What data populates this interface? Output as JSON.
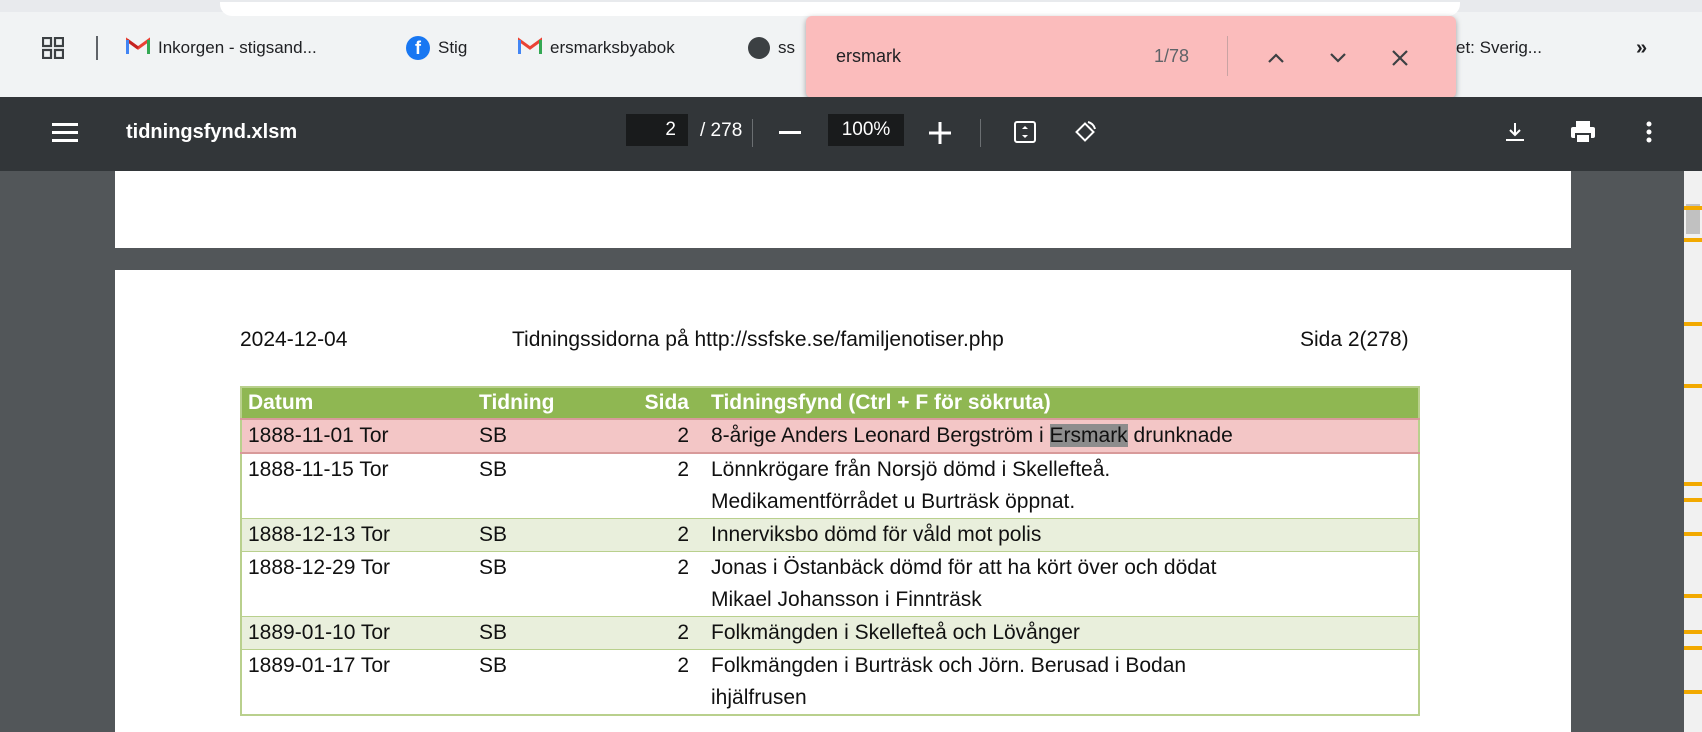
{
  "bookmarks": {
    "items": [
      {
        "label": "Inkorgen - stigsand...",
        "icon": "gmail-icon"
      },
      {
        "label": "Stig",
        "icon": "facebook-icon"
      },
      {
        "label": "ersmarksbyabok",
        "icon": "gmail-icon"
      },
      {
        "label": "ss",
        "icon": "globe-icon"
      },
      {
        "label": "et: Sverig...",
        "icon": ""
      }
    ],
    "overflow": "»"
  },
  "find": {
    "query": "ersmark",
    "count": "1/78"
  },
  "toolbar": {
    "filename": "tidningsfynd.xlsm",
    "page": "2",
    "page_total": "/ 278",
    "zoom": "100%"
  },
  "doc": {
    "date": "2024-12-04",
    "source": "Tidningssidorna på http://ssfske.se/familjenotiser.php",
    "page_label": "Sida  2(278)",
    "columns": [
      "Datum",
      "Tidning",
      "Sida",
      "Tidningsfynd (Ctrl + F för sökruta)"
    ],
    "rows": [
      {
        "datum": "1888-11-01 Tor",
        "tidning": "SB",
        "sida": "2",
        "fynd_before": "8-årige Anders Leonard Bergström i ",
        "fynd_match": "Ersmark",
        "fynd_after": " drunknade",
        "style": "hl"
      },
      {
        "datum": "1888-11-15 Tor",
        "tidning": "SB",
        "sida": "2",
        "fynd1": "Lönnkrögare från Norsjö dömd i Skellefteå.",
        "fynd2": "Medikamentförrådet u Burträsk öppnat.",
        "style": "plain"
      },
      {
        "datum": "1888-12-13 Tor",
        "tidning": "SB",
        "sida": "2",
        "fynd1": "Innerviksbo dömd för våld mot polis",
        "style": "alt"
      },
      {
        "datum": "1888-12-29 Tor",
        "tidning": "SB",
        "sida": "2",
        "fynd1": "Jonas i Östanbäck dömd för att ha kört över och dödat",
        "fynd2": "Mikael Johansson i Finnträsk",
        "style": "plain"
      },
      {
        "datum": "1889-01-10 Tor",
        "tidning": "SB",
        "sida": "2",
        "fynd1": "Folkmängden i Skellefteå och Lövånger",
        "style": "alt"
      },
      {
        "datum": "1889-01-17 Tor",
        "tidning": "SB",
        "sida": "2",
        "fynd1": "Folkmängden i Burträsk och Jörn. Berusad i Bodan",
        "fynd2": "ihjälfrusen",
        "style": "plain"
      }
    ]
  },
  "colors": {
    "find_bg": "#fbbcbc",
    "table_header": "#8fb752",
    "highlight_row": "#f3c6c6"
  }
}
